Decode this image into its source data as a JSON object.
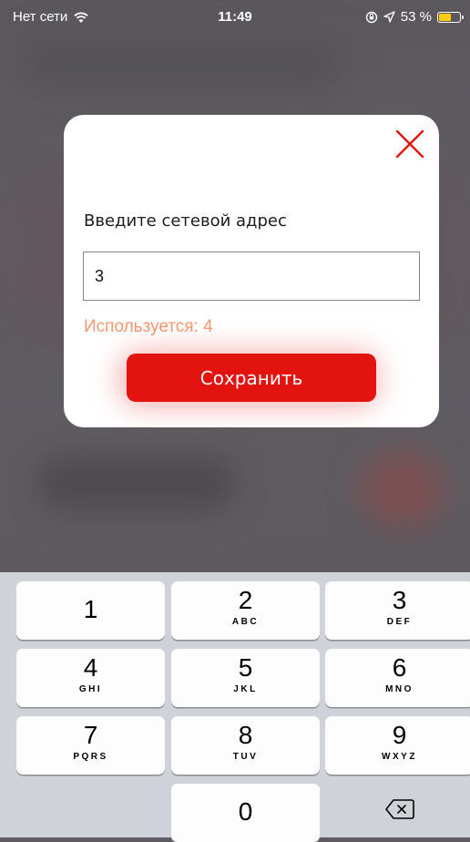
{
  "status_bar": {
    "carrier": "Нет сети",
    "time": "11:49",
    "battery": "53 %",
    "battery_level": 0.53
  },
  "dialog": {
    "title": "Введите сетевой адрес",
    "input_value": "3",
    "used_label": "Используется:",
    "used_value": "4",
    "save_label": "Сохранить",
    "close_icon": "close-icon"
  },
  "keyboard": {
    "keys": [
      {
        "digit": "1",
        "letters": ""
      },
      {
        "digit": "2",
        "letters": "ABC"
      },
      {
        "digit": "3",
        "letters": "DEF"
      },
      {
        "digit": "4",
        "letters": "GHI"
      },
      {
        "digit": "5",
        "letters": "JKL"
      },
      {
        "digit": "6",
        "letters": "MNO"
      },
      {
        "digit": "7",
        "letters": "PQRS"
      },
      {
        "digit": "8",
        "letters": "TUV"
      },
      {
        "digit": "9",
        "letters": "WXYZ"
      },
      {
        "digit": "0",
        "letters": ""
      }
    ],
    "delete_icon": "backspace-icon"
  },
  "colors": {
    "accent": "#e3140f",
    "used_text": "#f29a74",
    "battery": "#ffcc00"
  }
}
